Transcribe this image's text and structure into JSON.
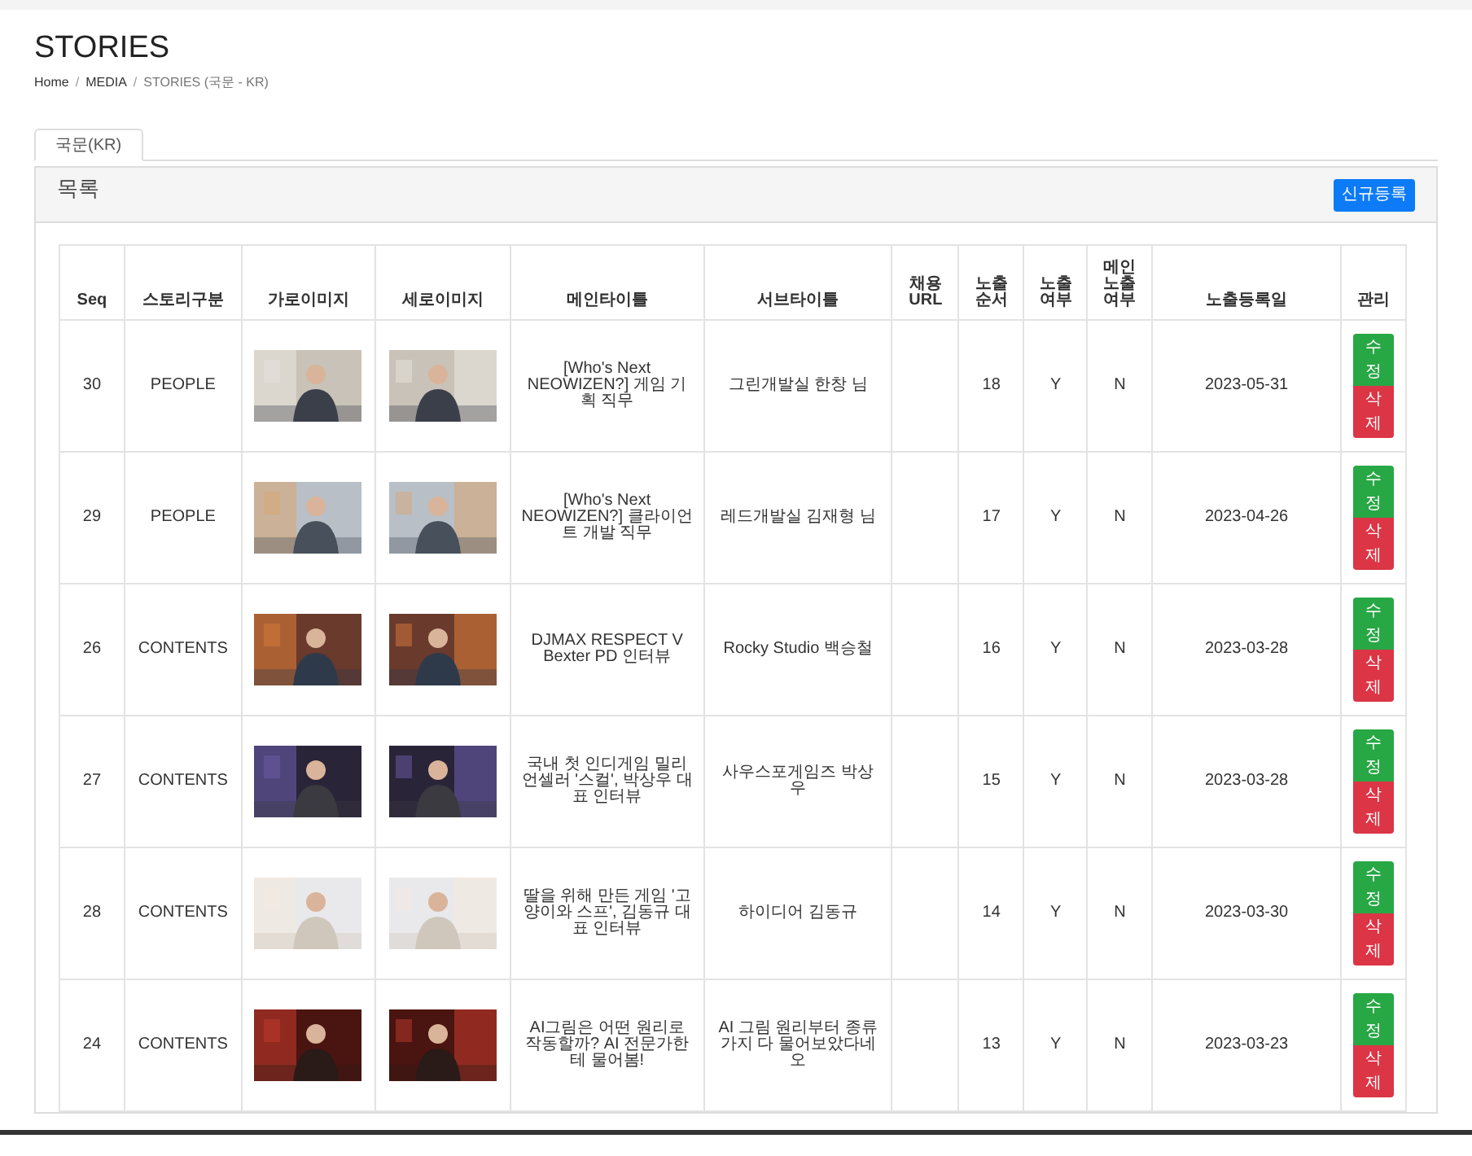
{
  "page_title": "STORIES",
  "breadcrumb_separator": "/",
  "breadcrumb": [
    {
      "label": "Home",
      "current": false
    },
    {
      "label": "MEDIA",
      "current": false
    },
    {
      "label": "STORIES (국문 - KR)",
      "current": true
    }
  ],
  "tabs": [
    {
      "label": "국문(KR)",
      "selected": true
    }
  ],
  "panel": {
    "title": "목록",
    "new_button": "신규등록"
  },
  "table": {
    "columns": [
      "Seq",
      "스토리구분",
      "가로이미지",
      "세로이미지",
      "메인타이틀",
      "서브타이틀",
      "채용 URL",
      "노출순서",
      "노출여부",
      "메인노출여부",
      "노출등록일",
      "관리"
    ],
    "rows": [
      {
        "seq": "30",
        "category": "PEOPLE",
        "main_title": "[Who's Next NEOWIZEN?] 게임 기획 직무",
        "sub_title": "그린개발실 한창 님",
        "order": "18",
        "exposed": "Y",
        "main_exposed": "N",
        "date": "2023-05-31",
        "edit": "수정",
        "delete": "삭제"
      },
      {
        "seq": "29",
        "category": "PEOPLE",
        "main_title": "[Who's Next NEOWIZEN?] 클라이언트 개발 직무",
        "sub_title": "레드개발실 김재형 님",
        "order": "17",
        "exposed": "Y",
        "main_exposed": "N",
        "date": "2023-04-26",
        "edit": "수정",
        "delete": "삭제"
      },
      {
        "seq": "26",
        "category": "CONTENTS",
        "main_title": "DJMAX RESPECT V Bexter PD 인터뷰",
        "sub_title": "Rocky Studio 백승철",
        "order": "16",
        "exposed": "Y",
        "main_exposed": "N",
        "date": "2023-03-28",
        "edit": "수정",
        "delete": "삭제"
      },
      {
        "seq": "27",
        "category": "CONTENTS",
        "main_title": "국내 첫 인디게임 밀리언셀러 '스컬', 박상우 대표 인터뷰",
        "sub_title": "사우스포게임즈 박상우",
        "order": "15",
        "exposed": "Y",
        "main_exposed": "N",
        "date": "2023-03-28",
        "edit": "수정",
        "delete": "삭제"
      },
      {
        "seq": "28",
        "category": "CONTENTS",
        "main_title": "딸을 위해 만든 게임 '고양이와 스프', 김동규 대표 인터뷰",
        "sub_title": "하이디어 김동규",
        "order": "14",
        "exposed": "Y",
        "main_exposed": "N",
        "date": "2023-03-30",
        "edit": "수정",
        "delete": "삭제"
      },
      {
        "seq": "24",
        "category": "CONTENTS",
        "main_title": "AI그림은 어떤 원리로 작동할까? AI 전문가한테 물어봄!",
        "sub_title": "AI 그림 원리부터 종류가지 다 물어보았다네오",
        "order": "13",
        "exposed": "Y",
        "main_exposed": "N",
        "date": "2023-03-23",
        "edit": "수정",
        "delete": "삭제"
      }
    ]
  }
}
